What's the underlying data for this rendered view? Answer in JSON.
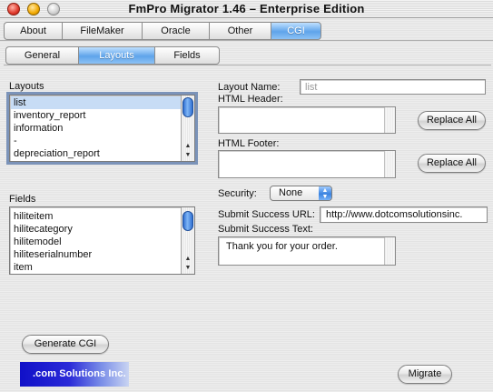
{
  "window": {
    "title": "FmPro Migrator 1.46 – Enterprise Edition"
  },
  "tabs_top": [
    {
      "label": "About"
    },
    {
      "label": "FileMaker"
    },
    {
      "label": "Oracle"
    },
    {
      "label": "Other"
    },
    {
      "label": "CGI",
      "active": true
    }
  ],
  "tabs_sub": [
    {
      "label": "General"
    },
    {
      "label": "Layouts",
      "active": true
    },
    {
      "label": "Fields"
    }
  ],
  "layouts": {
    "label": "Layouts",
    "items": [
      "list",
      "inventory_report",
      "information",
      "-",
      "depreciation_report"
    ],
    "selected": "list"
  },
  "fields": {
    "label": "Fields",
    "items": [
      "hiliteitem",
      "hilitecategory",
      "hilitemodel",
      "hiliteserialnumber",
      "item"
    ]
  },
  "layout_name": {
    "label": "Layout Name:",
    "value": "list"
  },
  "html_header": {
    "label": "HTML Header:",
    "value": "",
    "button": "Replace All"
  },
  "html_footer": {
    "label": "HTML Footer:",
    "value": "",
    "button": "Replace All"
  },
  "security": {
    "label": "Security:",
    "value": "None"
  },
  "submit_success_url": {
    "label": "Submit Success URL:",
    "value": "http://www.dotcomsolutionsinc."
  },
  "submit_success_text": {
    "label": "Submit Success Text:",
    "value": "Thank you for your order."
  },
  "buttons": {
    "generate_cgi": "Generate CGI",
    "migrate": "Migrate"
  },
  "logo": {
    "text": ".com Solutions Inc."
  }
}
